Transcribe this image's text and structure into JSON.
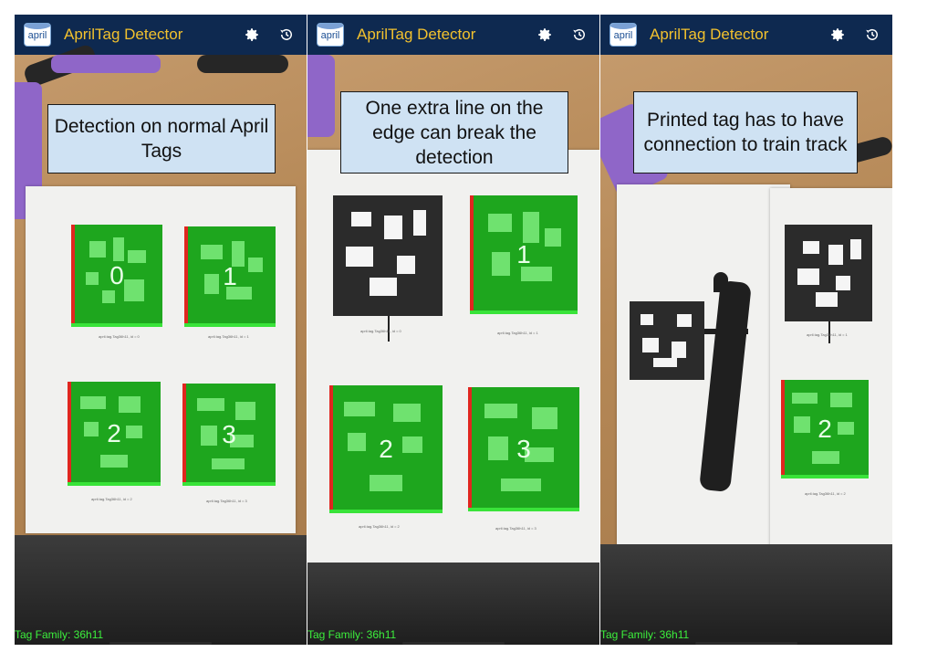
{
  "app": {
    "title": "AprilTag Detector",
    "logo_text": "april",
    "icons": [
      "gear-icon",
      "history-icon"
    ]
  },
  "colors": {
    "appbar": "#0e2950",
    "title": "#f2c12e",
    "tag_fill": "#1ea61e",
    "tag_pattern": "#6fe26f",
    "tag_left_edge": "#e0261f",
    "tag_bottom_edge": "#39e339",
    "note_bg": "#cfe2f3",
    "family_text": "#3cf03c"
  },
  "panels": [
    {
      "note": "Detection on normal April Tags",
      "family": "Tag Family: 36h11",
      "tags": [
        {
          "id": "0",
          "caption": "april.tag.Tag36h11, id = 0"
        },
        {
          "id": "1",
          "caption": "april.tag.Tag36h11, id = 1"
        },
        {
          "id": "2",
          "caption": "april.tag.Tag36h11, id = 2"
        },
        {
          "id": "3",
          "caption": "april.tag.Tag36h11, id = 3"
        }
      ]
    },
    {
      "note": "One extra line on the edge can break the detection",
      "family": "Tag Family: 36h11",
      "tags": [
        {
          "id": "",
          "caption": "april.tag.Tag36h11, id = 0"
        },
        {
          "id": "1",
          "caption": "april.tag.Tag36h11, id = 1"
        },
        {
          "id": "2",
          "caption": "april.tag.Tag36h11, id = 2"
        },
        {
          "id": "3",
          "caption": "april.tag.Tag36h11, id = 3"
        }
      ]
    },
    {
      "note": "Printed tag has to have connection to train track",
      "family": "Tag Family: 36h11",
      "tags": [
        {
          "id": "",
          "caption": "april.tag.Tag36h11, id = 1"
        },
        {
          "id": "2",
          "caption": "april.tag.Tag36h11, id = 2"
        }
      ]
    }
  ]
}
